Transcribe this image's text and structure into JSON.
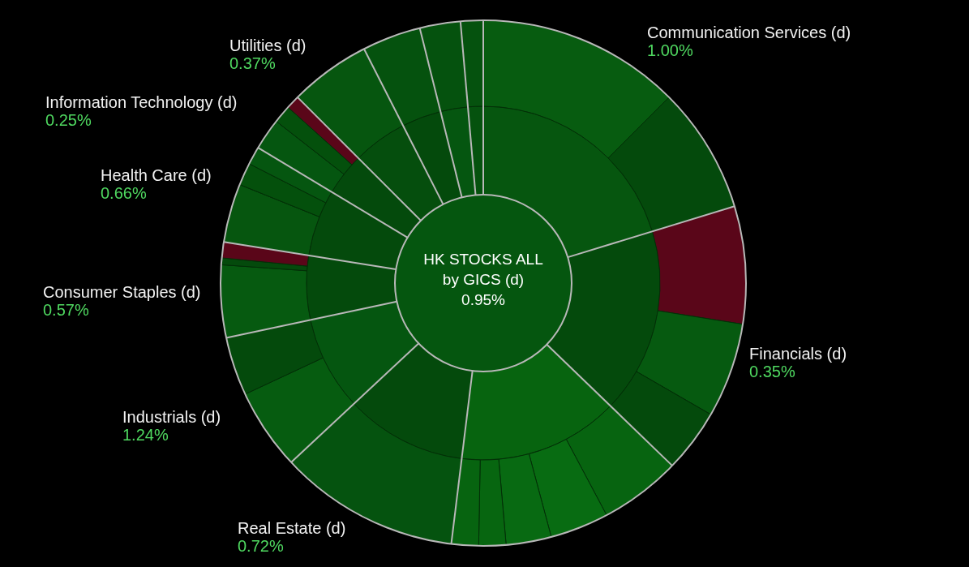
{
  "chart": {
    "title": "HK STOCKS ALL",
    "subtitle": "by GICS (d)",
    "change": "0.95%"
  },
  "sectors": [
    {
      "label": "Communication Services (d)",
      "change": "1.00%"
    },
    {
      "label": "Utilities (d)",
      "change": "0.37%"
    },
    {
      "label": "Information Technology (d)",
      "change": "0.25%"
    },
    {
      "label": "Health Care (d)",
      "change": "0.66%"
    },
    {
      "label": "Consumer Staples (d)",
      "change": "0.57%"
    },
    {
      "label": "Financials (d)",
      "change": "0.35%"
    },
    {
      "label": "Industrials (d)",
      "change": "1.24%"
    },
    {
      "label": "Real Estate (d)",
      "change": "0.72%"
    }
  ]
}
